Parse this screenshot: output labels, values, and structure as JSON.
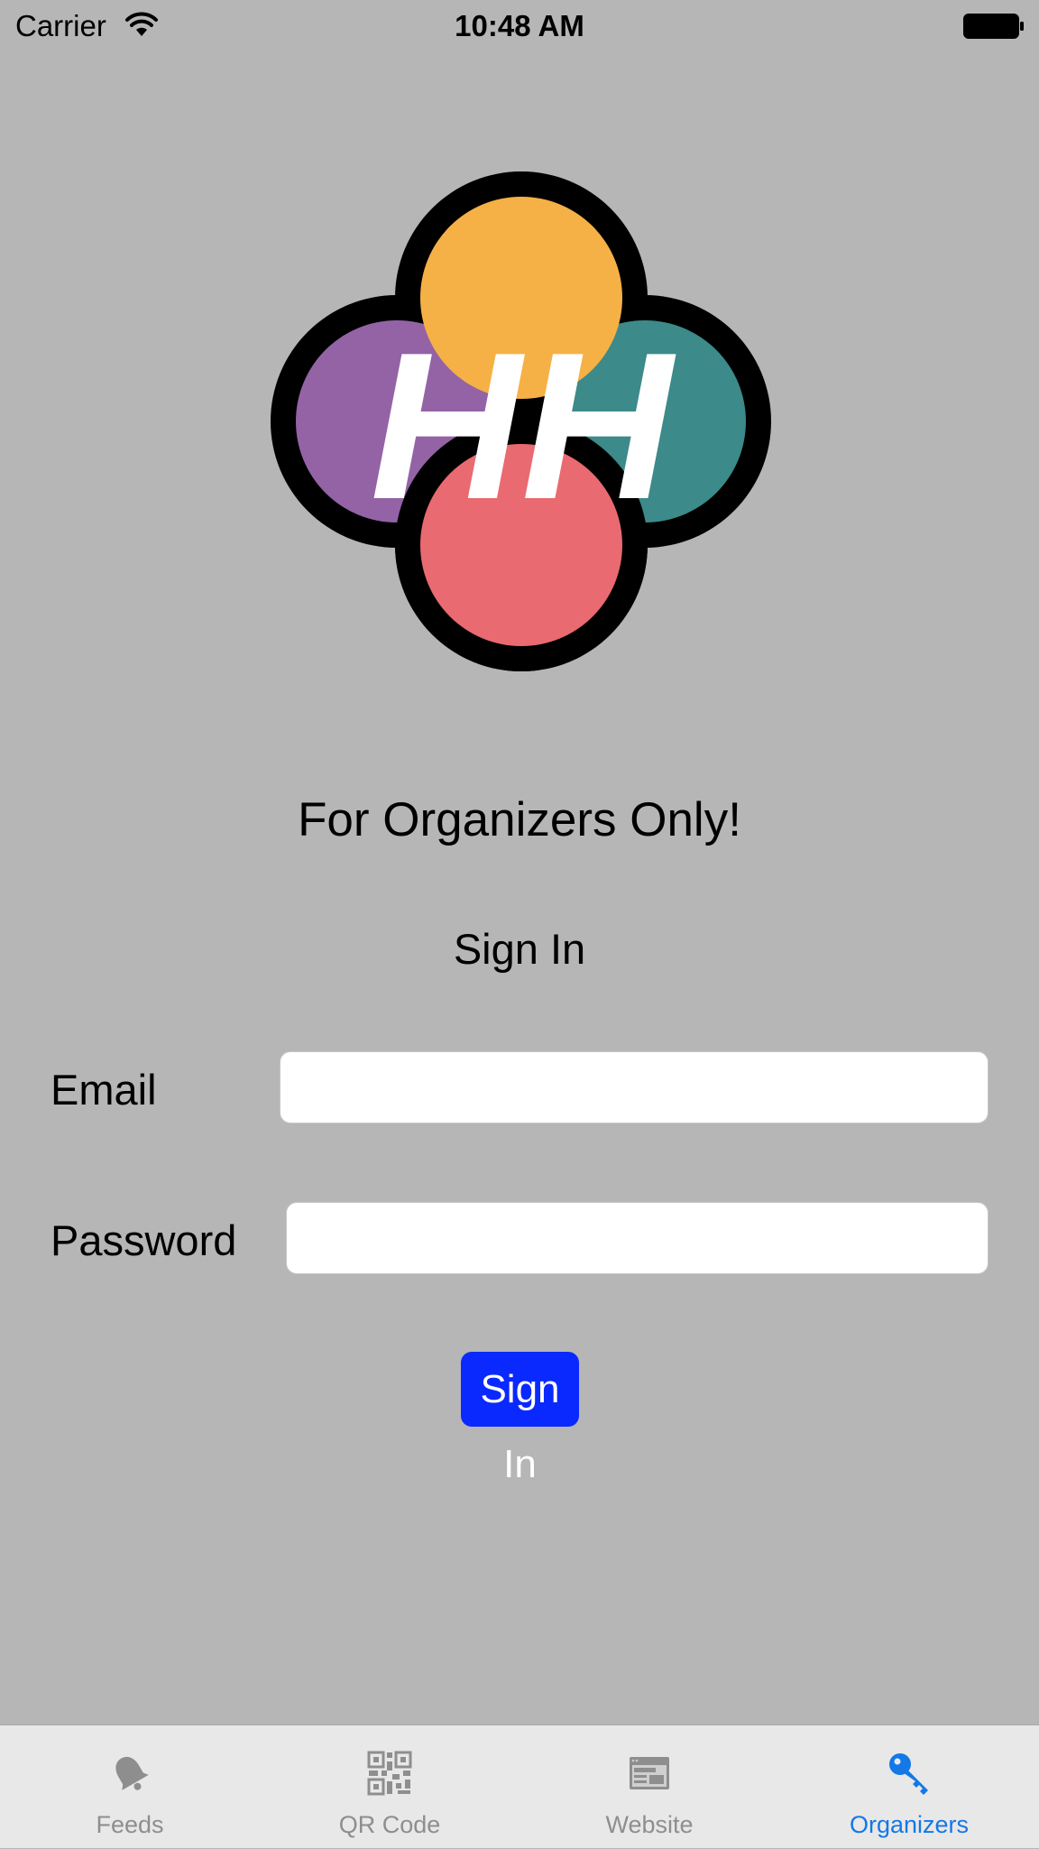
{
  "status_bar": {
    "carrier": "Carrier",
    "time": "10:48 AM",
    "wifi_icon": "wifi-icon",
    "battery_icon": "battery-icon"
  },
  "logo": {
    "text": "HH",
    "colors": {
      "top": "#f5b146",
      "left": "#9363a6",
      "right": "#3c8a8a",
      "bottom": "#e96a70",
      "outline": "#000000"
    }
  },
  "heading": "For Organizers Only!",
  "subheading": "Sign In",
  "form": {
    "email_label": "Email",
    "email_value": "",
    "password_label": "Password",
    "password_value": "",
    "submit_label": "Sign In",
    "submit_color": "#0a29ff"
  },
  "tabs": [
    {
      "label": "Feeds",
      "icon": "bell-icon",
      "active": false
    },
    {
      "label": "QR Code",
      "icon": "qr-code-icon",
      "active": false
    },
    {
      "label": "Website",
      "icon": "browser-window-icon",
      "active": false
    },
    {
      "label": "Organizers",
      "icon": "key-icon",
      "active": true
    }
  ],
  "colors": {
    "background": "#b6b6b6",
    "tab_active": "#1478e6",
    "tab_inactive": "#8e8e8e"
  }
}
